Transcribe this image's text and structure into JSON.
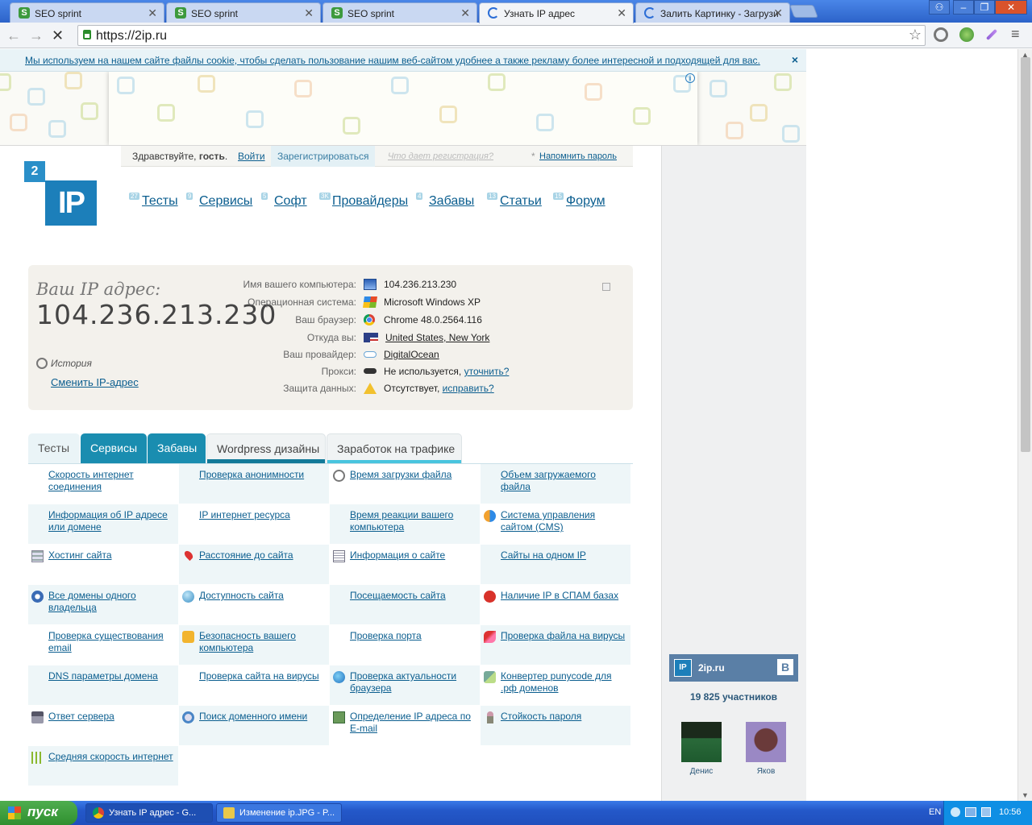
{
  "browser": {
    "tabs": [
      {
        "title": "SEO sprint",
        "icon": "seo-sprint-favicon"
      },
      {
        "title": "SEO sprint",
        "icon": "seo-sprint-favicon"
      },
      {
        "title": "SEO sprint",
        "icon": "seo-sprint-favicon"
      },
      {
        "title": "Узнать IP адрес",
        "icon": "loading-spinner",
        "active": true
      },
      {
        "title": "Залить Картинку - Загрузи",
        "icon": "loading-spinner"
      }
    ],
    "url": "https://2ip.ru"
  },
  "cookie_notice": {
    "text": "Мы используем на нашем сайте файлы cookie, чтобы сделать пользование нашим веб-сайтом удобнее а также рекламу более интересной и подходящей для вас.",
    "close": "×"
  },
  "login_bar": {
    "greeting": "Здравствуйте,",
    "guest": "гость",
    "login": "Войти",
    "register": "Зарегистрироваться",
    "what_gives": "Что дает регистрация?",
    "remind": "Напомнить пароль"
  },
  "logo": {
    "small": "2",
    "big": "IP"
  },
  "nav": [
    {
      "label": "Тесты",
      "count": "27"
    },
    {
      "label": "Сервисы",
      "count": "9"
    },
    {
      "label": "Софт",
      "count": "5"
    },
    {
      "label": "Провайдеры",
      "count": "3K"
    },
    {
      "label": "Забавы",
      "count": "4"
    },
    {
      "label": "Статьи",
      "count": "13"
    },
    {
      "label": "Форум",
      "count": "15"
    }
  ],
  "ip_block": {
    "label": "Ваш IP адрес:",
    "ip": "104.236.213.230",
    "history": "История",
    "change": "Сменить IP-адрес",
    "rows": [
      {
        "key": "Имя вашего компьютера:",
        "value": "104.236.213.230",
        "icon": "computer-icon"
      },
      {
        "key": "Операционная система:",
        "value": "Microsoft Windows XP",
        "icon": "windows-icon"
      },
      {
        "key": "Ваш браузер:",
        "value": "Chrome 48.0.2564.116",
        "icon": "chrome-icon"
      },
      {
        "key": "Откуда вы:",
        "value": "United States, New York",
        "icon": "us-flag-icon",
        "link": true
      },
      {
        "key": "Ваш провайдер:",
        "value": "DigitalOcean",
        "icon": "cloud-icon",
        "link": true
      },
      {
        "key": "Прокси:",
        "value": "Не используется,",
        "extra": "уточнить?",
        "icon": "glasses-icon"
      },
      {
        "key": "Защита данных:",
        "value": "Отсутствует,",
        "extra": "исправить?",
        "icon": "warning-icon"
      }
    ]
  },
  "page_tabs": [
    "Тесты",
    "Сервисы",
    "Забавы",
    "Wordpress дизайны",
    "Заработок на трафике"
  ],
  "grid": [
    [
      {
        "text": "Скорость интернет соединения",
        "icon": ""
      },
      {
        "text": "Проверка анонимности",
        "icon": ""
      },
      {
        "text": "Время загрузки файла",
        "icon": "clock-icon"
      },
      {
        "text": "Объем загружаемого файла",
        "icon": ""
      }
    ],
    [
      {
        "text": "Информация об IP адресе или домене",
        "icon": ""
      },
      {
        "text": "IP интернет ресурса",
        "icon": ""
      },
      {
        "text": "Время реакции вашего компьютера",
        "icon": ""
      },
      {
        "text": "Система управления сайтом (CMS)",
        "icon": "cms-icon"
      }
    ],
    [
      {
        "text": "Хостинг сайта",
        "icon": "server-icon"
      },
      {
        "text": "Расстояние до сайта",
        "icon": "pin-icon"
      },
      {
        "text": "Информация о сайте",
        "icon": "document-icon"
      },
      {
        "text": "Сайты на одном IP",
        "icon": ""
      }
    ],
    [
      {
        "text": "Все домены одного владельца",
        "icon": "owner-icon"
      },
      {
        "text": "Доступность сайта",
        "icon": "globe-icon"
      },
      {
        "text": "Посещаемость сайта",
        "icon": ""
      },
      {
        "text": "Наличие IP в СПАМ базах",
        "icon": "spam-icon"
      }
    ],
    [
      {
        "text": "Проверка существования email",
        "icon": ""
      },
      {
        "text": "Безопасность вашего компьютера",
        "icon": "lock-icon"
      },
      {
        "text": "Проверка порта",
        "icon": ""
      },
      {
        "text": "Проверка файла на вирусы",
        "icon": "virus-icon"
      }
    ],
    [
      {
        "text": "DNS параметры домена",
        "icon": ""
      },
      {
        "text": "Проверка сайта на вирусы",
        "icon": ""
      },
      {
        "text": "Проверка актуальности браузера",
        "icon": "browser-icon"
      },
      {
        "text": "Конвертер punycode для .рф доменов",
        "icon": "convert-icon"
      }
    ],
    [
      {
        "text": "Ответ сервера",
        "icon": "server-response-icon"
      },
      {
        "text": "Поиск доменного имени",
        "icon": "search-domain-icon"
      },
      {
        "text": "Определение IP адреса по E-mail",
        "icon": "email-icon"
      },
      {
        "text": "Стойкость пароля",
        "icon": "key-icon"
      }
    ],
    [
      {
        "text": "Средняя скорость интернет",
        "icon": "bars-icon"
      }
    ]
  ],
  "vk_widget": {
    "name": "2ip.ru",
    "logo": "IP",
    "vk_letter": "B",
    "members": "19 825 участников",
    "people": [
      {
        "name": "Денис"
      },
      {
        "name": "Яков"
      }
    ]
  },
  "taskbar": {
    "start": "пуск",
    "windows": [
      "Узнать IP адрес - G...",
      "Изменение ip.JPG - P..."
    ],
    "lang": "EN",
    "time": "10:56"
  }
}
